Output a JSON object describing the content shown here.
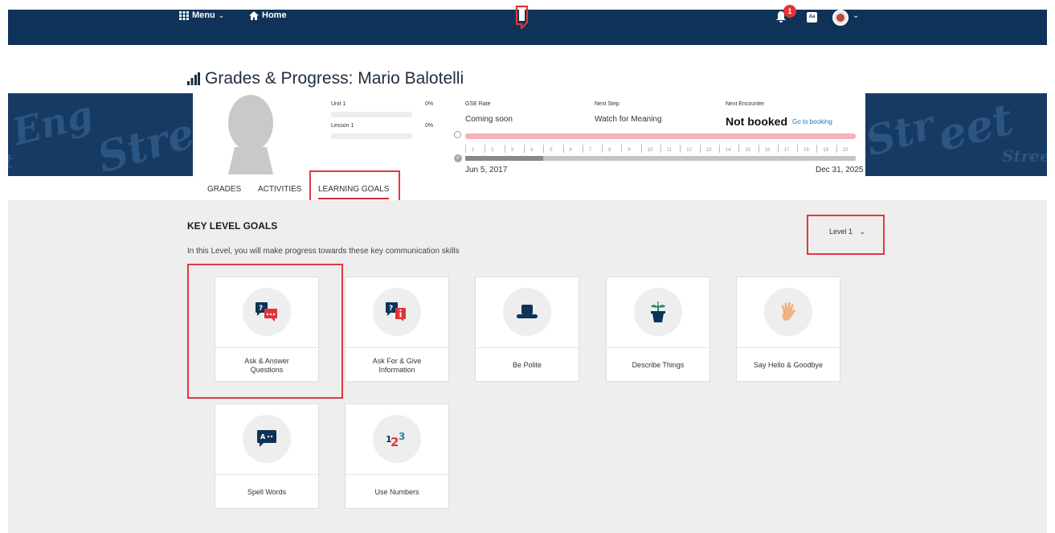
{
  "nav": {
    "menu_label": "Menu",
    "home_label": "Home",
    "notification_count": "1",
    "dict_label": "Aa"
  },
  "page": {
    "title": "Grades & Progress: Mario Balotelli"
  },
  "progress": {
    "unit_label": "Unit 1",
    "unit_pct": "0%",
    "lesson_label": "Lesson 1",
    "lesson_pct": "0%"
  },
  "stats": {
    "gse_label": "GSE Rate",
    "gse_value": "Coming soon",
    "next_step_label": "Next Step",
    "next_step_value": "Watch for Meaning",
    "next_enc_label": "Next Encounter",
    "next_enc_value": "Not booked",
    "booking_link": "Go to booking"
  },
  "timeline": {
    "ticks": [
      "1",
      "2",
      "3",
      "4",
      "5",
      "6",
      "7",
      "8",
      "9",
      "10",
      "11",
      "12",
      "13",
      "14",
      "15",
      "16",
      "17",
      "18",
      "19",
      "20"
    ],
    "start_date": "Jun 5, 2017",
    "end_date": "Dec 31, 2025",
    "elapsed_fraction": 0.2
  },
  "tabs": [
    "GRADES",
    "ACTIVITIES",
    "LEARNING GOALS"
  ],
  "goals": {
    "title": "KEY LEVEL GOALS",
    "subtitle": "In this Level, you will make progress towards these key communication skills",
    "level_select": "Level 1",
    "cards": [
      {
        "label": "Ask & Answer Questions",
        "icon": "question-answer-chat-icon"
      },
      {
        "label": "Ask For & Give Information",
        "icon": "question-info-chat-icon"
      },
      {
        "label": "Be Polite",
        "icon": "top-hat-icon"
      },
      {
        "label": "Describe Things",
        "icon": "plant-pot-icon"
      },
      {
        "label": "Say Hello & Goodbye",
        "icon": "waving-hand-icon"
      },
      {
        "label": "Spell Words",
        "icon": "letters-speech-bubble-icon"
      },
      {
        "label": "Use Numbers",
        "icon": "numbers-123-icon"
      }
    ]
  },
  "colors": {
    "navy": "#0f3358",
    "accent_red": "#e2333a",
    "content_bg": "#eeeeee"
  }
}
